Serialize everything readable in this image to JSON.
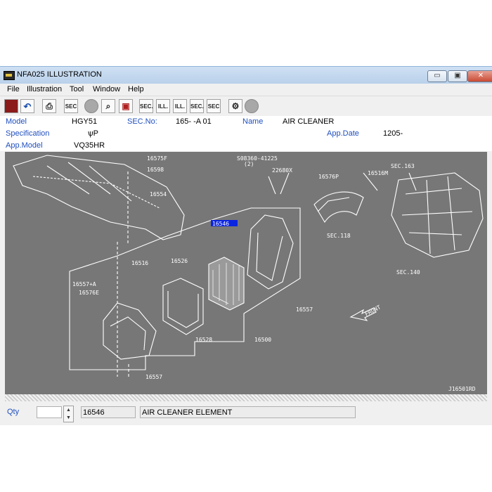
{
  "window": {
    "title": "NFA025  ILLUSTRATION",
    "minimize": "▭",
    "maximize": "▣",
    "close": "✕"
  },
  "menu": [
    "File",
    "Illustration",
    "Tool",
    "Window",
    "Help"
  ],
  "toolbar": {
    "sec1": "SEC",
    "sec2": "SEC.",
    "ill1": "ILL.",
    "ill2": "ILL.",
    "sec3": "SEC.",
    "sec4": "SEC"
  },
  "info": {
    "model_label": "Model",
    "model_value": "HGY51",
    "secno_label": "SEC.No:",
    "secno_value": "165-  -A 01",
    "name_label": "Name",
    "name_value": "AIR CLEANER",
    "spec_label": "Specification",
    "spec_value": "ѱР",
    "appdate_label": "App.Date",
    "appdate_value": "1205-",
    "appmodel_label": "App.Model",
    "appmodel_value": "VQ35HR"
  },
  "diagram": {
    "labels": [
      "16575F",
      "16598",
      "16554",
      "S08360-41225",
      "(2)",
      "22680X",
      "16576P",
      "16516M",
      "SEC.163",
      "16546",
      "SEC.118",
      "16526",
      "16516",
      "16557+A",
      "16576E",
      "16557",
      "FRONT",
      "16528",
      "16500",
      "16557",
      "SEC.140",
      "J16501RD"
    ],
    "highlighted_part": "16546"
  },
  "bottom": {
    "qty_label": "Qty",
    "qty_value": "",
    "part_no": "16546",
    "part_name": "AIR CLEANER ELEMENT"
  }
}
